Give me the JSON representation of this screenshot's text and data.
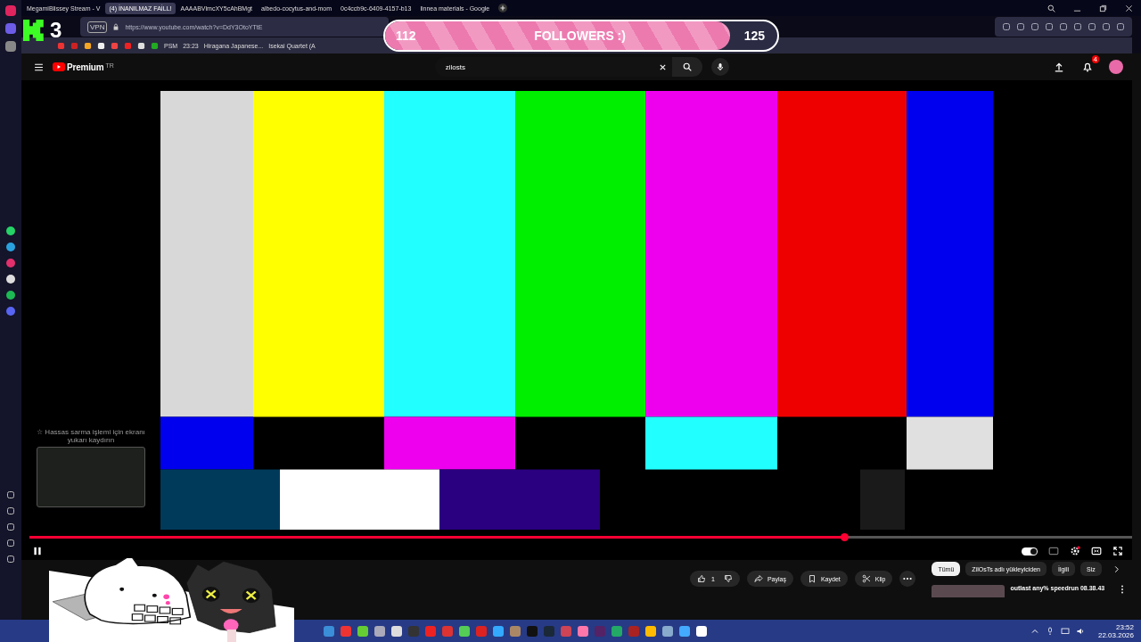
{
  "browser": {
    "tabs": [
      {
        "title": "MegamiBlissey Stream - V",
        "selected": false
      },
      {
        "title": "(4) İNANILMAZ FAİLL!",
        "selected": true
      },
      {
        "title": "AAAABVlmcXY5cAhBMgt",
        "selected": false
      },
      {
        "title": "albedo-cocytus-and-mom",
        "selected": false
      },
      {
        "title": "0c4ccb9c-6409-4157-b13",
        "selected": false
      },
      {
        "title": "linnea materials - Google",
        "selected": false
      }
    ],
    "vpn": "VPN",
    "url": "https://www.youtube.com/watch?v=DdY3OtoYTtE",
    "bookmarks": [
      {
        "label": "PSM"
      },
      {
        "label": "23:23"
      },
      {
        "label": "Hiragana Japanese..."
      },
      {
        "label": "Isekai Quartet (A"
      }
    ]
  },
  "overlay": {
    "kick_count": "3",
    "followers": {
      "start": "112",
      "label": "FOLLOWERS :)",
      "goal": "125",
      "level": 0.88
    }
  },
  "youtube": {
    "logo": "Premium",
    "region": "TR",
    "search": {
      "value": "zilosts"
    },
    "notifications": "4",
    "player": {
      "level": 0.74,
      "tip": "☆ Hassas sarma işlemi için ekranı yukarı kaydırın"
    },
    "autoplay": {
      "on": true
    },
    "likes": "1",
    "actions": [
      {
        "kind": "share",
        "label": "Paylaş"
      },
      {
        "kind": "save",
        "label": "Kaydet"
      },
      {
        "kind": "clip",
        "label": "Klip"
      }
    ],
    "chips": [
      {
        "label": "Tümü",
        "selected": true
      },
      {
        "label": "ZilOsTs adlı yükleyiciden",
        "selected": false
      },
      {
        "label": "İlgili",
        "selected": false
      },
      {
        "label": "Siz",
        "selected": false
      }
    ],
    "recommendation": {
      "title": "outlast any% speedrun 08.38.43"
    }
  },
  "taskbar": {
    "time": "23:52",
    "date": "22.03.2026"
  }
}
